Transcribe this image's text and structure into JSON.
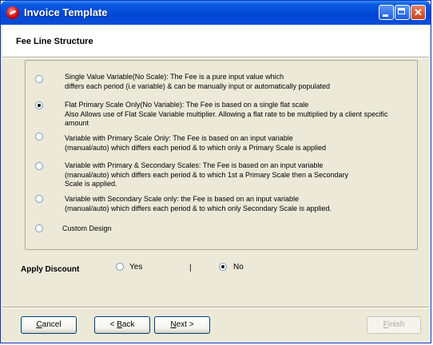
{
  "window": {
    "title": "Invoice Template"
  },
  "header": {
    "heading": "Fee Line Structure"
  },
  "fee_options": [
    {
      "lines": [
        "Single Value Variable(No Scale): The Fee is a pure input value which",
        "differs each period (i.e variable) & can be manually input or automatically populated"
      ],
      "checked": false
    },
    {
      "lines": [
        "Flat Primary Scale Only(No Variable): The Fee is based on a single flat scale",
        "Also Allows use of Flat Scale Variable multiplier. Allowing a flat rate to be multiplied by a client specific",
        "amount"
      ],
      "checked": true
    },
    {
      "lines": [
        "Variable with Primary Scale Only: The Fee is based on an input variable",
        "(manual/auto) which differs each period & to which only a Primary Scale is applied"
      ],
      "checked": false
    },
    {
      "lines": [
        "Variable with Primary & Secondary Scales: The Fee is based on an input variable",
        "(manual/auto) which differs each period & to which 1st a Primary Scale then a Secondary",
        "Scale is applied."
      ],
      "checked": false
    },
    {
      "lines": [
        "Variable with Secondary Scale only: the Fee is based on an input variable",
        "(manual/auto) which differs each period & to which only Secondary Scale is applied."
      ],
      "checked": false
    },
    {
      "lines": [
        "Custom Design"
      ],
      "checked": false
    }
  ],
  "discount": {
    "label": "Apply Discount",
    "yes_label": "Yes",
    "separator": "|",
    "no_label": "No",
    "selected": "No"
  },
  "buttons": {
    "cancel": {
      "underline": "C",
      "rest": "ancel"
    },
    "back": {
      "prefix": "< ",
      "underline": "B",
      "rest": "ack"
    },
    "next": {
      "underline": "N",
      "rest": "ext >"
    },
    "finish": {
      "underline": "F",
      "rest": "inish",
      "disabled": true
    }
  },
  "colors": {
    "titlebar": "#0046d5",
    "dialog_bg": "#ece9d8",
    "button_border": "#003c74"
  }
}
